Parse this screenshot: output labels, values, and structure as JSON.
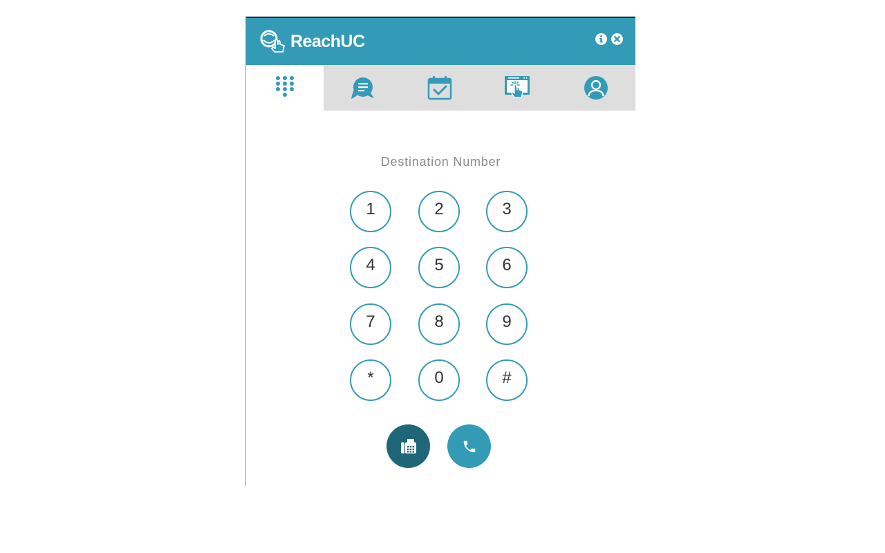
{
  "app": {
    "name": "ReachUC",
    "brand_color": "#349bb6",
    "dark_color": "#1f6678"
  },
  "header": {
    "actions": [
      {
        "icon": "info-icon"
      },
      {
        "icon": "close-icon"
      }
    ]
  },
  "tabs": [
    {
      "icon": "dialpad-icon",
      "active": true
    },
    {
      "icon": "chat-icon",
      "active": false
    },
    {
      "icon": "calendar-check-icon",
      "active": false
    },
    {
      "icon": "screen-click-icon",
      "active": false
    },
    {
      "icon": "user-profile-icon",
      "active": false
    }
  ],
  "dialer": {
    "destination_label": "Destination Number",
    "keys": [
      "1",
      "2",
      "3",
      "4",
      "5",
      "6",
      "7",
      "8",
      "9",
      "*",
      "0",
      "#"
    ],
    "actions": [
      {
        "icon": "fax-icon"
      },
      {
        "icon": "phone-icon"
      }
    ]
  }
}
